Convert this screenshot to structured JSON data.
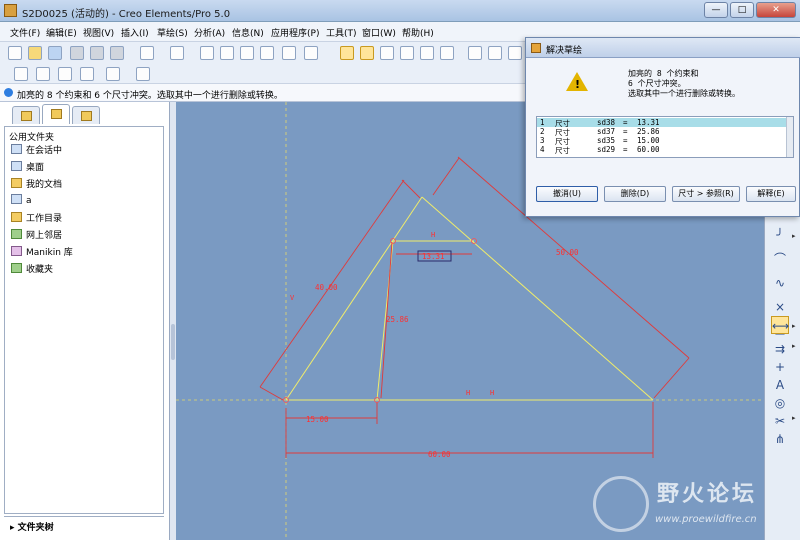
{
  "window": {
    "title": "S2D0025 (活动的) - Creo Elements/Pro 5.0"
  },
  "menu": [
    "文件(F)",
    "编辑(E)",
    "视图(V)",
    "插入(I)",
    "草绘(S)",
    "分析(A)",
    "信息(N)",
    "应用程序(P)",
    "工具(T)",
    "窗口(W)",
    "帮助(H)"
  ],
  "message": "加亮的 8 个约束和 6 个尺寸冲突。选取其中一个进行删除或转换。",
  "folder_panel": {
    "header": "公用文件夹",
    "items": [
      "在会话中",
      "桌面",
      "我的文档",
      "a",
      "工作目录",
      "网上邻居",
      "Manikin 库",
      "收藏夹"
    ],
    "tree_label": "文件夹树"
  },
  "sketch": {
    "dims": {
      "d40": "40.00",
      "d50": "50.00",
      "d1331": "13.31",
      "d2586": "25.86",
      "d15": "15.00",
      "d60": "60.00"
    },
    "labels": {
      "h_top": "H",
      "v_left": "V",
      "h1": "H",
      "h2": "H"
    }
  },
  "dialog": {
    "title": "解决草绘",
    "message_lines": [
      "加亮的 8 个约束和",
      "6 个尺寸冲突。",
      "选取其中一个进行删除或转换。"
    ],
    "rows": [
      {
        "num": "1",
        "type": "尺寸",
        "name": "sd38",
        "eq": "=",
        "value": "13.31"
      },
      {
        "num": "2",
        "type": "尺寸",
        "name": "sd37",
        "eq": "=",
        "value": "25.86"
      },
      {
        "num": "3",
        "type": "尺寸",
        "name": "sd35",
        "eq": "=",
        "value": "15.00"
      },
      {
        "num": "4",
        "type": "尺寸",
        "name": "sd29",
        "eq": "=",
        "value": "60.00"
      }
    ],
    "buttons": {
      "undo": "撤消(U)",
      "delete": "删除(D)",
      "ref": "尺寸 > 参照(R)",
      "explain": "解释(E)"
    }
  },
  "watermark": {
    "cn": "野火论坛",
    "url": "www.proewildfire.cn"
  }
}
